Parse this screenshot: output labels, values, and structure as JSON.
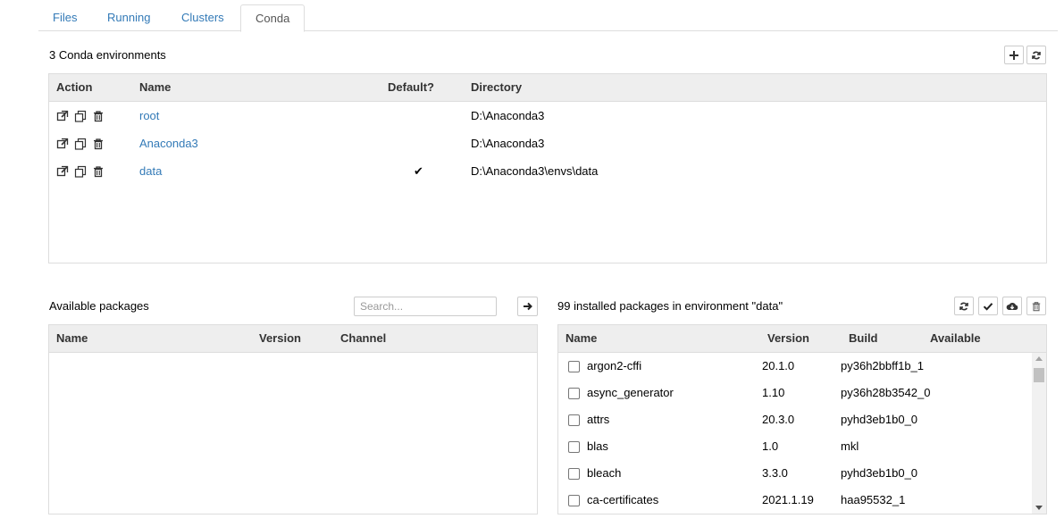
{
  "tabs": [
    {
      "label": "Files"
    },
    {
      "label": "Running"
    },
    {
      "label": "Clusters"
    },
    {
      "label": "Conda"
    }
  ],
  "environments": {
    "header": "3 Conda environments",
    "columns": {
      "action": "Action",
      "name": "Name",
      "default": "Default?",
      "directory": "Directory"
    },
    "rows": [
      {
        "name": "root",
        "default": "",
        "directory": "D:\\Anaconda3"
      },
      {
        "name": "Anaconda3",
        "default": "",
        "directory": "D:\\Anaconda3"
      },
      {
        "name": "data",
        "default": "✔",
        "directory": "D:\\Anaconda3\\envs\\data"
      }
    ]
  },
  "available": {
    "header": "Available packages",
    "search_placeholder": "Search...",
    "columns": {
      "name": "Name",
      "version": "Version",
      "channel": "Channel"
    }
  },
  "installed": {
    "header": "99 installed packages in environment \"data\"",
    "columns": {
      "name": "Name",
      "version": "Version",
      "build": "Build",
      "available": "Available"
    },
    "rows": [
      {
        "name": "argon2-cffi",
        "version": "20.1.0",
        "build": "py36h2bbff1b_1"
      },
      {
        "name": "async_generator",
        "version": "1.10",
        "build": "py36h28b3542_0"
      },
      {
        "name": "attrs",
        "version": "20.3.0",
        "build": "pyhd3eb1b0_0"
      },
      {
        "name": "blas",
        "version": "1.0",
        "build": "mkl"
      },
      {
        "name": "bleach",
        "version": "3.3.0",
        "build": "pyhd3eb1b0_0"
      },
      {
        "name": "ca-certificates",
        "version": "2021.1.19",
        "build": "haa95532_1"
      }
    ]
  },
  "icons": {
    "env_actions": [
      "external-link-icon",
      "clone-icon",
      "trash-icon"
    ],
    "env_toolbar": [
      "plus-icon",
      "refresh-icon"
    ],
    "search_go": "arrow-right-icon",
    "pkg_toolbar": [
      "refresh-icon",
      "check-icon",
      "cloud-download-icon",
      "trash-icon"
    ]
  },
  "colors": {
    "link": "#337ab7",
    "header_bg": "#eeeeee",
    "border": "#dddddd"
  }
}
